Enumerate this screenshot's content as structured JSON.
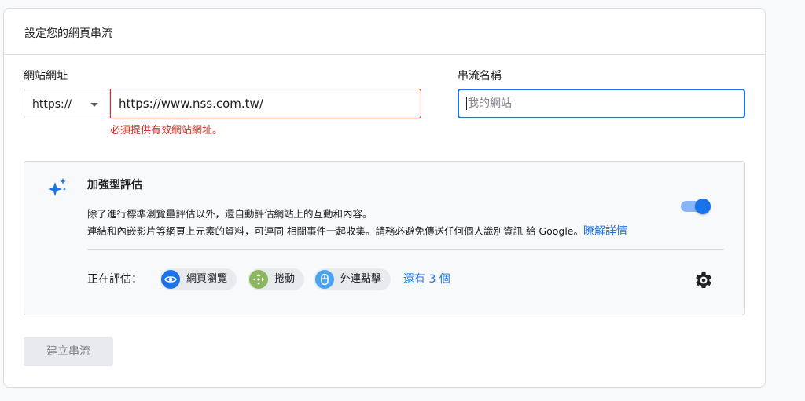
{
  "card": {
    "title": "設定您的網頁串流"
  },
  "website_url": {
    "label": "網站網址",
    "protocol": "https://",
    "value": "https://www.nss.com.tw/",
    "error": "必須提供有效網站網址。"
  },
  "stream_name": {
    "label": "串流名稱",
    "placeholder": "我的網站"
  },
  "enhanced_measurement": {
    "title": "加強型評估",
    "description_line1": "除了進行標準瀏覽量評估以外，還自動評估網站上的互動和內容。",
    "description_line2": "連結和內嵌影片等網頁上元素的資料，可連同 相關事件一起收集。請務必避免傳送任何個人識別資訊 給 Google。",
    "learn_more": "瞭解詳情",
    "toggle_on": true,
    "measuring_label": "正在評估：",
    "chips": [
      {
        "label": "網頁瀏覽",
        "icon": "eye-icon",
        "color": "#1a73e8"
      },
      {
        "label": "捲動",
        "icon": "move-icon",
        "color": "#8ab85c"
      },
      {
        "label": "外連點擊",
        "icon": "mouse-icon",
        "color": "#4aa3f0"
      }
    ],
    "more_link": "還有 3 個",
    "settings_icon": "gear-icon"
  },
  "actions": {
    "create_stream": "建立串流"
  },
  "colors": {
    "accent": "#1a73e8",
    "error": "#d93025"
  }
}
